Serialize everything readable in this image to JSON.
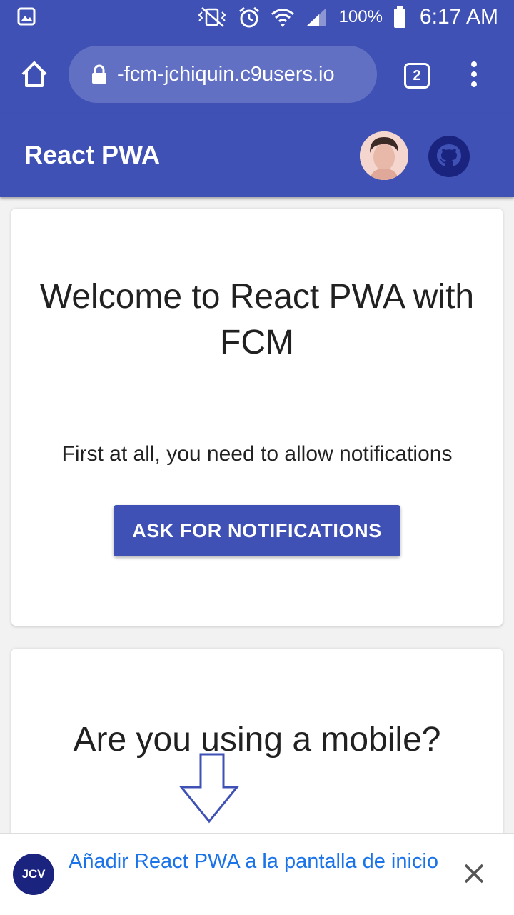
{
  "status_bar": {
    "battery": "100%",
    "time": "6:17 AM",
    "icons": [
      "gallery-icon",
      "vibrate-off-icon",
      "alarm-icon",
      "wifi-icon",
      "signal-icon",
      "battery-icon"
    ]
  },
  "browser": {
    "url": "-fcm-jchiquin.c9users.io",
    "tab_count": "2"
  },
  "app_bar": {
    "title": "React PWA"
  },
  "cards": {
    "welcome_title": "Welcome to React PWA with FCM",
    "welcome_text": "First at all, you need to allow notifications",
    "button_label": "ASK FOR NOTIFICATIONS",
    "mobile_title": "Are you using a mobile?"
  },
  "banner": {
    "icon_text": "JCV",
    "text": "Añadir React PWA a la pantalla de inicio"
  },
  "colors": {
    "primary": "#3f51b5",
    "link": "#1a73e8"
  }
}
